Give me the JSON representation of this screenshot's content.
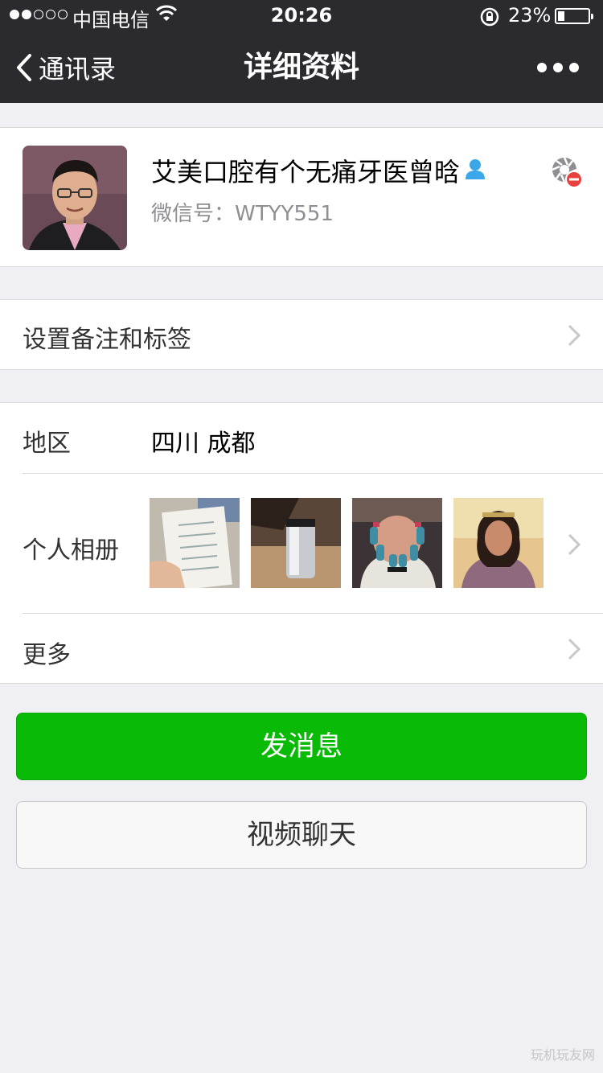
{
  "status_bar": {
    "carrier": "中国电信",
    "time": "20:26",
    "battery": "23%",
    "battery_level": 0.23,
    "signal_bars_filled": 2,
    "signal_bars_total": 5
  },
  "nav": {
    "back_label": "通讯录",
    "title": "详细资料",
    "more_icon": "more-dots-icon"
  },
  "profile": {
    "nickname": "艾美口腔有个无痛牙医曾晗",
    "wechat_id": "微信号：WTYY551",
    "avatar_icon": "avatar-photo",
    "contact_icon": "contact-person-icon",
    "star_icon": "star-friend-icon"
  },
  "remark": {
    "label": "设置备注和标签"
  },
  "info": {
    "region_label": "地区",
    "region_value": "四川 成都",
    "album_label": "个人相册",
    "more_label": "更多"
  },
  "buttons": {
    "send_message": "发消息",
    "video_chat": "视频聊天"
  },
  "colors": {
    "header_bg": "#2b2b2f",
    "page_bg": "#efeff4",
    "primary_green": "#09bb07",
    "badge_red": "#e64340",
    "contact_icon_blue": "#3aa7e8"
  },
  "watermark": "玩机玩友网"
}
